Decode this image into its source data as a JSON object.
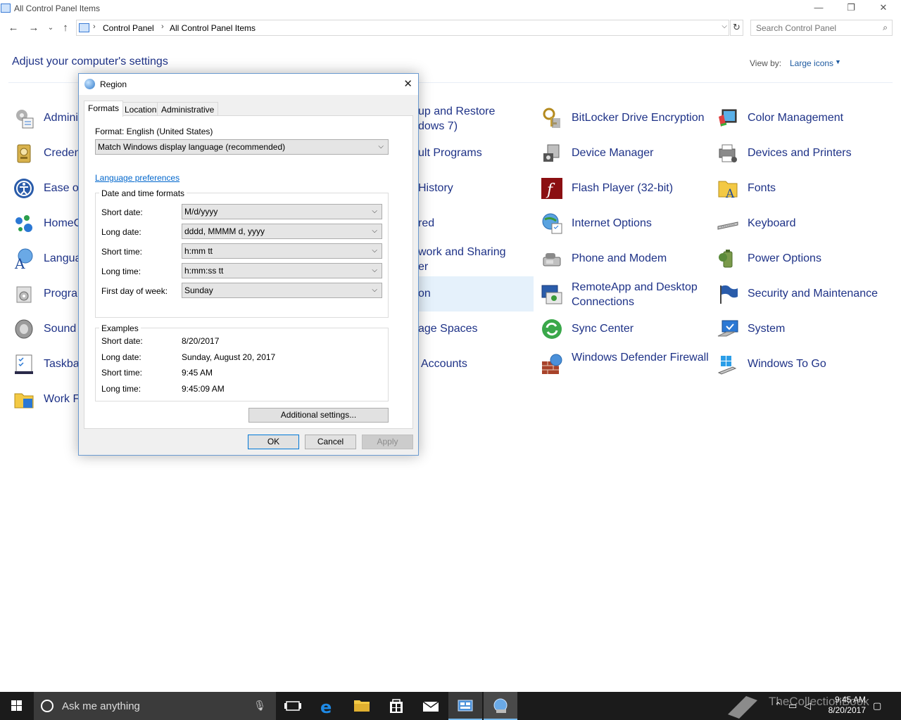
{
  "window": {
    "title": "All Control Panel Items",
    "minimize": "—",
    "restore": "❐",
    "close": "✕"
  },
  "address": {
    "crumbs": [
      "Control Panel",
      "All Control Panel Items"
    ],
    "search_placeholder": "Search Control Panel"
  },
  "main": {
    "heading": "Adjust your computer's settings",
    "view_by_label": "View by:",
    "view_by_value": "Large icons"
  },
  "items": {
    "col1": [
      "Admini",
      "Creden",
      "Ease of",
      "HomeG",
      "Langua",
      "Progra",
      "Sound",
      "Taskbar",
      "Work F"
    ],
    "col2": [
      "up and Restore",
      "dows 7)",
      "ult Programs",
      "History",
      "red",
      "work and Sharing",
      "er",
      "on",
      "age Spaces",
      "Accounts"
    ],
    "col3": [
      "BitLocker Drive Encryption",
      "Device Manager",
      "Flash Player (32-bit)",
      "Internet Options",
      "Phone and Modem",
      "RemoteApp and Desktop Connections",
      "Sync Center",
      "Windows Defender Firewall"
    ],
    "col4": [
      "Color Management",
      "Devices and Printers",
      "Fonts",
      "Keyboard",
      "Power Options",
      "Security and Maintenance",
      "System",
      "Windows To Go"
    ]
  },
  "dialog": {
    "title": "Region",
    "tabs": [
      "Formats",
      "Location",
      "Administrative"
    ],
    "format_label": "Format: English (United States)",
    "format_value": "Match Windows display language (recommended)",
    "language_link": "Language preferences",
    "dt_group": "Date and time formats",
    "fields": [
      {
        "label": "Short date:",
        "value": "M/d/yyyy"
      },
      {
        "label": "Long date:",
        "value": "dddd, MMMM d, yyyy"
      },
      {
        "label": "Short time:",
        "value": "h:mm tt"
      },
      {
        "label": "Long time:",
        "value": "h:mm:ss tt"
      },
      {
        "label": "First day of week:",
        "value": "Sunday"
      }
    ],
    "examples_group": "Examples",
    "examples": [
      {
        "label": "Short date:",
        "value": "8/20/2017"
      },
      {
        "label": "Long date:",
        "value": "Sunday, August 20, 2017"
      },
      {
        "label": "Short time:",
        "value": "9:45 AM"
      },
      {
        "label": "Long time:",
        "value": "9:45:09 AM"
      }
    ],
    "additional": "Additional settings...",
    "ok": "OK",
    "cancel": "Cancel",
    "apply": "Apply"
  },
  "taskbar": {
    "search_text": "Ask me anything",
    "time": "9:45 AM",
    "date": "8/20/2017",
    "watermark": "TheCollectionBook"
  }
}
